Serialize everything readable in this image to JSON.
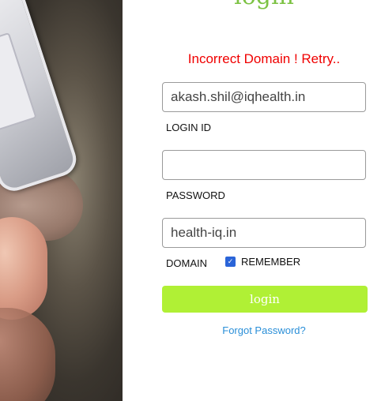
{
  "page": {
    "title": "login",
    "error": "Incorrect Domain ! Retry.."
  },
  "login_id": {
    "value": "akash.shil@iqhealth.in",
    "label": "LOGIN ID"
  },
  "password": {
    "value": "",
    "label": "PASSWORD"
  },
  "domain": {
    "value": "health-iq.in",
    "label": "DOMAIN"
  },
  "remember": {
    "label": "REMEMBER",
    "checked": true
  },
  "buttons": {
    "login_label": "login"
  },
  "links": {
    "forgot": "Forgot Password?"
  },
  "colors": {
    "accent": "#b0f035",
    "title": "#7cc243",
    "error": "#f00000",
    "link": "#2a8fd8"
  }
}
